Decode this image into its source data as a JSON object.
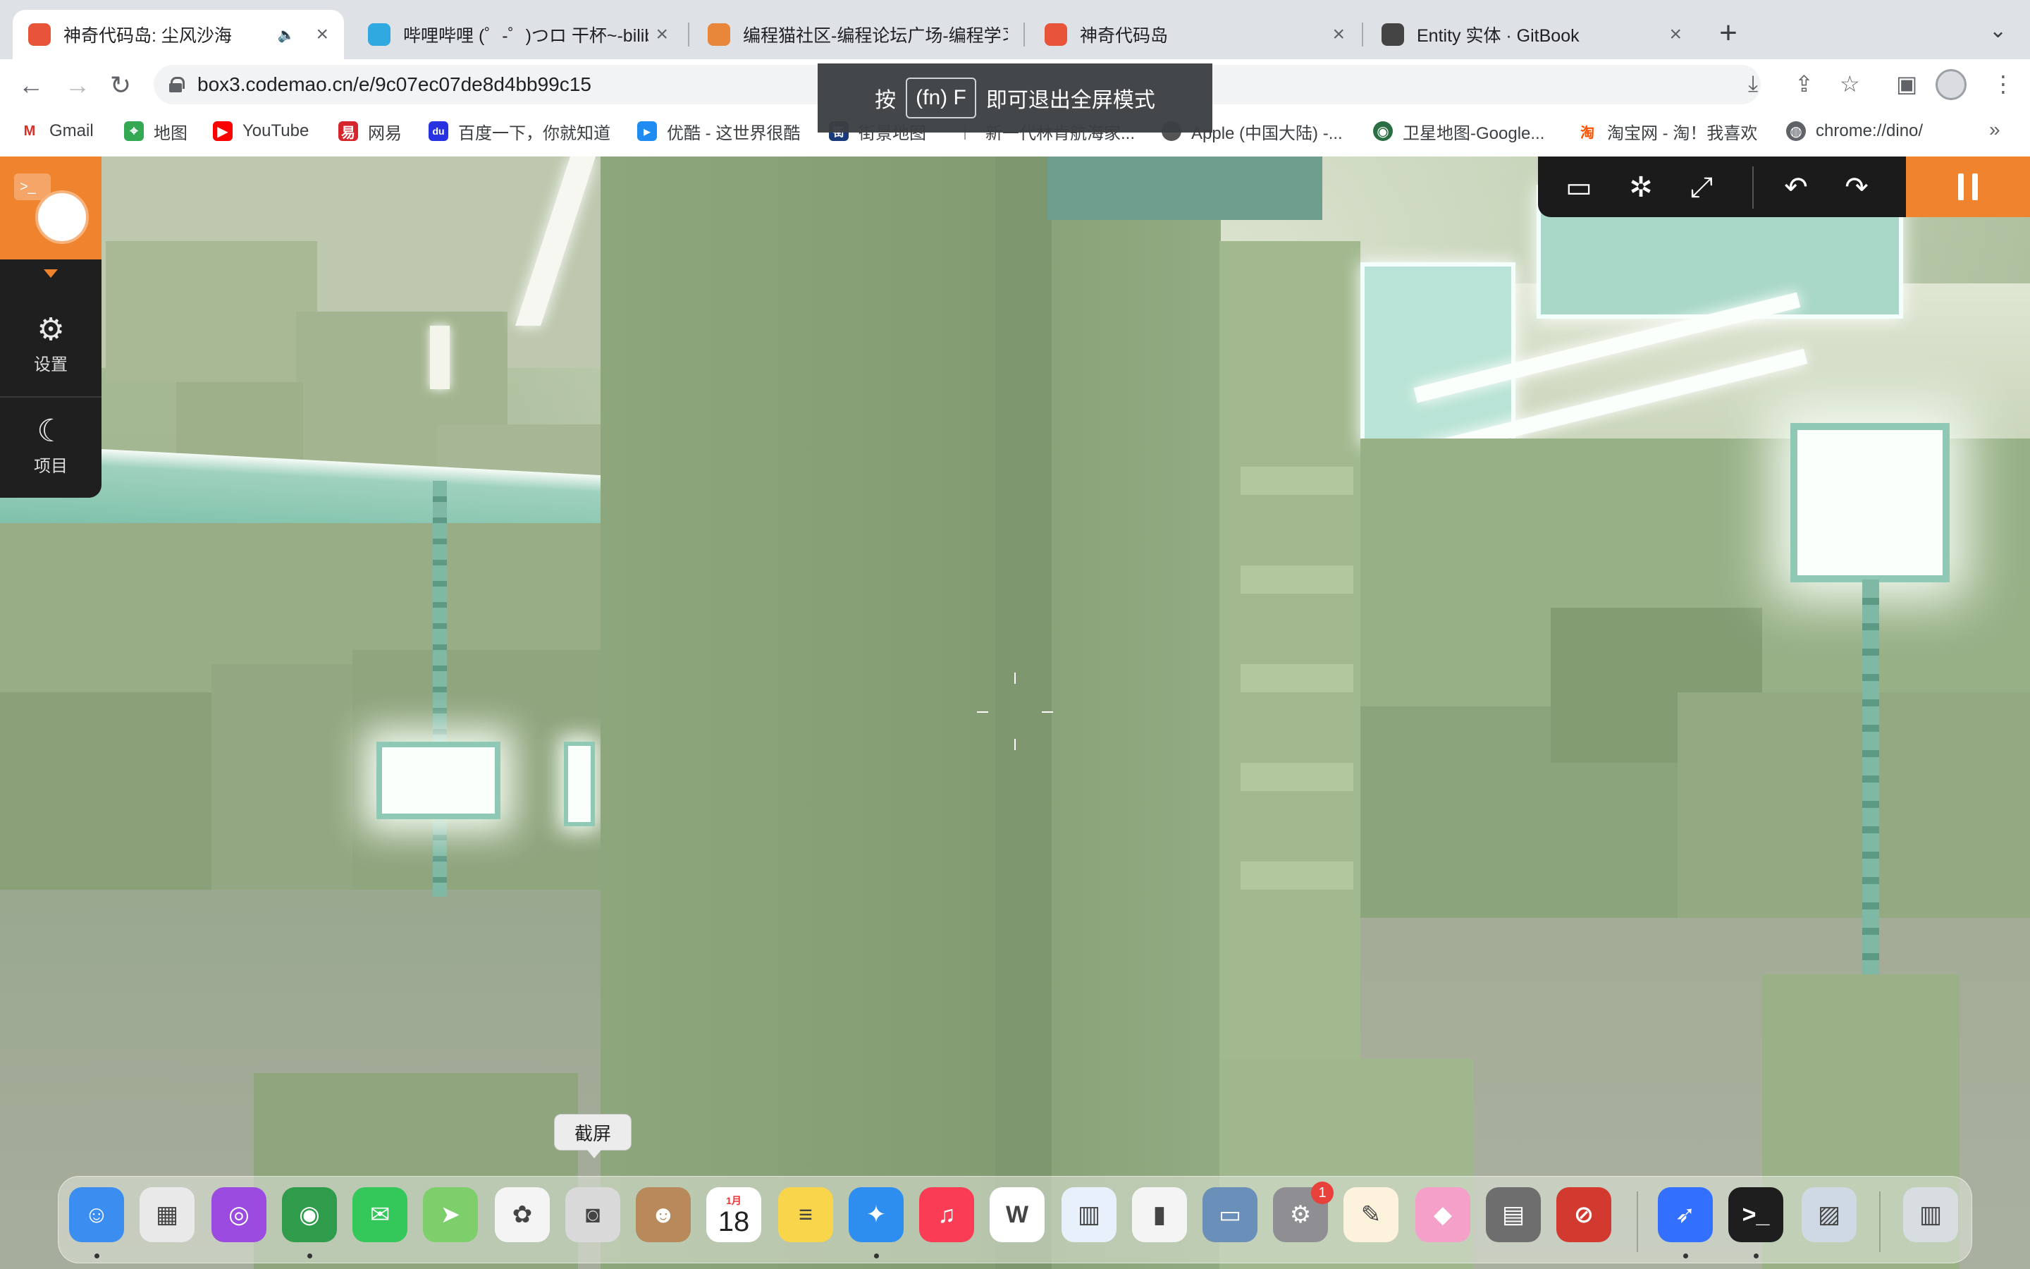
{
  "tabs": [
    {
      "title": "神奇代码岛: 尘风沙海",
      "active": true,
      "audio": "🔈",
      "fav_color": "#e8543a"
    },
    {
      "title": "哔哩哔哩 (゜-゜)つロ 干杯~-bilibili",
      "active": false,
      "fav_color": "#2fa9e0"
    },
    {
      "title": "编程猫社区-编程论坛广场-编程学习",
      "active": false,
      "fav_color": "#e8863a"
    },
    {
      "title": "神奇代码岛",
      "active": false,
      "fav_color": "#e8543a"
    },
    {
      "title": "Entity 实体 · GitBook",
      "active": false,
      "fav_color": "#444444"
    }
  ],
  "tab_close": "×",
  "new_tab": "+",
  "tab_menu": "⌄",
  "nav": {
    "back": "←",
    "forward": "→",
    "reload": "↻"
  },
  "address": {
    "url": "box3.codemao.cn/e/9c07ec07de8d4bb99c15"
  },
  "toolbar_icons": {
    "install": "⤓",
    "share": "⇪",
    "bookmark_star": "☆",
    "side_panel": "▣",
    "menu": "⋮"
  },
  "bookmarks": [
    {
      "label": "Gmail",
      "icon": "M",
      "color": "#d93025"
    },
    {
      "label": "地图",
      "icon": "⌖",
      "color": "#34a853"
    },
    {
      "label": "YouTube",
      "icon": "▶",
      "color": "#ff0000"
    },
    {
      "label": "网易",
      "icon": "易",
      "color": "#d5262e"
    },
    {
      "label": "百度一下，你就知道",
      "icon": "du",
      "color": "#2932e1"
    },
    {
      "label": "优酷 - 这世界很酷",
      "icon": "▸",
      "color": "#1e8cf0"
    },
    {
      "label": "街景地图",
      "icon": "街",
      "color": "#1a3a7a"
    },
    {
      "label": "新一代林肯航海家...",
      "icon": "│",
      "color": "#777777"
    },
    {
      "label": "Apple (中国大陆) -...",
      "icon": "",
      "color": "#555555"
    },
    {
      "label": "卫星地图-Google...",
      "icon": "◉",
      "color": "#2b6e44"
    },
    {
      "label": "淘宝网 - 淘！我喜欢",
      "icon": "淘",
      "color": "#ff5000"
    },
    {
      "label": "chrome://dino/",
      "icon": "◍",
      "color": "#5f6368"
    }
  ],
  "bookmarks_more": "»",
  "fullscreen_toast": {
    "prefix": "按",
    "key": "(fn) F",
    "suffix": "即可退出全屏模式"
  },
  "editor_sidebar": {
    "code_icon": ">_",
    "items": [
      {
        "label": "设置",
        "icon": "⚙"
      },
      {
        "label": "项目",
        "icon": "☾"
      }
    ]
  },
  "game_toolbar": {
    "chat": "▭",
    "debug": "✲",
    "fullscreen": "⤢",
    "undo": "↶",
    "redo": "↷"
  },
  "dock": {
    "tooltip": "截屏",
    "calendar_month": "1月",
    "calendar_day": "18",
    "settings_badge": "1",
    "apps": [
      {
        "name": "finder",
        "glyph": "☺",
        "color": "#3b8ef0"
      },
      {
        "name": "launchpad",
        "glyph": "▦",
        "color": "#e9e9e9"
      },
      {
        "name": "podcasts",
        "glyph": "◎",
        "color": "#9b4be0"
      },
      {
        "name": "chrome",
        "glyph": "◉",
        "color": "#2e9c4a"
      },
      {
        "name": "messages",
        "glyph": "✉",
        "color": "#34c759"
      },
      {
        "name": "maps",
        "glyph": "➤",
        "color": "#7ccf6b"
      },
      {
        "name": "photos",
        "glyph": "✿",
        "color": "#f4f4f4"
      },
      {
        "name": "screenshot",
        "glyph": "◙",
        "color": "#d9d9d9"
      },
      {
        "name": "contacts",
        "glyph": "☻",
        "color": "#b8895a"
      },
      {
        "name": "calendar",
        "glyph": "",
        "color": "#ffffff"
      },
      {
        "name": "notes",
        "glyph": "≡",
        "color": "#f8d54a"
      },
      {
        "name": "safari",
        "glyph": "✦",
        "color": "#2d8ef0"
      },
      {
        "name": "music",
        "glyph": "♫",
        "color": "#fa3d55"
      },
      {
        "name": "wps",
        "glyph": "W",
        "color": "#ffffff"
      },
      {
        "name": "keynote",
        "glyph": "▥",
        "color": "#e8f1fb"
      },
      {
        "name": "numbers",
        "glyph": "▮",
        "color": "#f4f4f4"
      },
      {
        "name": "screenshot-folder",
        "glyph": "▭",
        "color": "#6a8fb8"
      },
      {
        "name": "system-settings",
        "glyph": "⚙",
        "color": "#8e8e93"
      },
      {
        "name": "pages",
        "glyph": "✎",
        "color": "#fdf3dc"
      },
      {
        "name": "grapher",
        "glyph": "◆",
        "color": "#f4a0c8"
      },
      {
        "name": "calculator",
        "glyph": "▤",
        "color": "#6e6e6e"
      },
      {
        "name": "instruments",
        "glyph": "⊘",
        "color": "#d23a2f"
      },
      {
        "name": "feishu",
        "glyph": "➶",
        "color": "#3370ff"
      },
      {
        "name": "terminal",
        "glyph": ">_",
        "color": "#1e1e1e"
      },
      {
        "name": "preview",
        "glyph": "▨",
        "color": "#cfd9e3"
      },
      {
        "name": "trash",
        "glyph": "▥",
        "color": "#d8dde2"
      }
    ]
  }
}
